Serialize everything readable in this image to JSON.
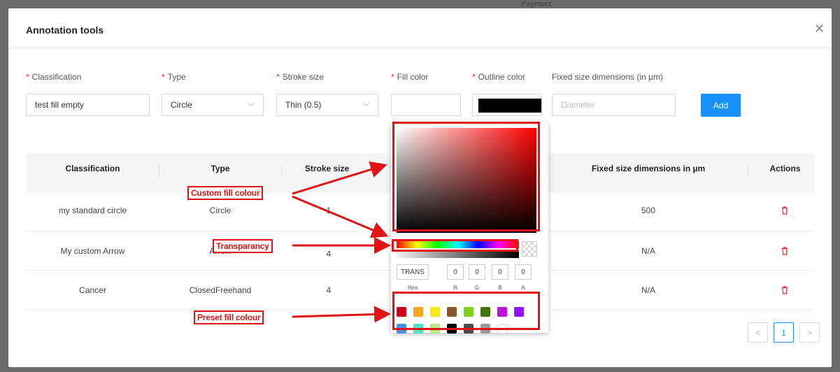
{
  "background": {
    "peek_text": "Payment"
  },
  "modal": {
    "title": "Annotation tools",
    "close_glyph": "✕"
  },
  "form": {
    "labels": {
      "classification": "Classification",
      "type": "Type",
      "stroke_size": "Stroke size",
      "fill_color": "Fill color",
      "outline_color": "Outline color",
      "fixed_size": "Fixed size dimensions (in µm)"
    },
    "required_mark": "*",
    "classification_value": "test fill empty",
    "type_value": "Circle",
    "stroke_value": "Thin (0.5)",
    "diameter_placeholder": "Diameter",
    "add_label": "Add",
    "outline_color_value": "#000000"
  },
  "table": {
    "headers": [
      "Classification",
      "Type",
      "Stroke size",
      "Fixed size dimensions in µm",
      "Actions"
    ],
    "rows": [
      {
        "classification": "my standard circle",
        "type": "Circle",
        "stroke": "1",
        "fixed": "500",
        "color": "#e53935"
      },
      {
        "classification": "My custom Arrow",
        "type": "Arrow",
        "stroke": "4",
        "fixed": "N/A",
        "color": "#a020f0"
      },
      {
        "classification": "Cancer",
        "type": "ClosedFreehand",
        "stroke": "4",
        "fixed": "N/A",
        "color": "#2e7d32"
      }
    ]
  },
  "pagination": {
    "prev": "<",
    "page": "1",
    "next": ">"
  },
  "picker": {
    "hex_value": "TRANS",
    "r": "0",
    "g": "0",
    "b": "0",
    "a": "0",
    "labels": {
      "hex": "Hex",
      "r": "R",
      "g": "G",
      "b": "B",
      "a": "A"
    },
    "presets": [
      "#d0021b",
      "#f5a623",
      "#f8e71c",
      "#8b572a",
      "#7ed321",
      "#417505",
      "#bd10e0",
      "#9013fe",
      "#4a90e2",
      "#50e3c2",
      "#b8e986",
      "#000000",
      "#4a4a4a",
      "#9b9b9b",
      "#ffffff"
    ]
  },
  "callouts": {
    "custom": "Custom fill colour",
    "transparency": "Transparancy",
    "preset": "Preset fill colour"
  },
  "accent_colors": {
    "primary": "#1890ff",
    "danger": "#f5222d",
    "annotation": "#e01414"
  }
}
